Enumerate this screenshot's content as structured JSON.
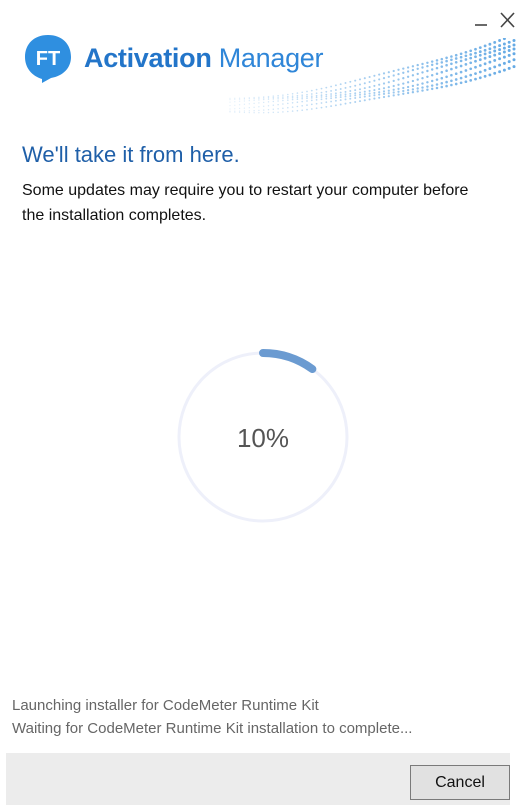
{
  "window": {
    "controls": {
      "minimize_icon": "minimize-icon",
      "close_icon": "close-icon"
    }
  },
  "brand": {
    "logo_text": "FT",
    "name_bold": "Activation",
    "name_light": " Manager",
    "accent_color": "#2375c9"
  },
  "main": {
    "heading": "We'll take it from here.",
    "description": "Some updates may require you to restart your computer before the installation completes."
  },
  "progress": {
    "percent": 10,
    "label": "10%",
    "track_color": "#eef0fa",
    "fill_color": "#6b9bd1"
  },
  "log": {
    "lines": [
      "Launching installer for CodeMeter Runtime Kit",
      "Waiting for CodeMeter Runtime Kit installation to complete..."
    ]
  },
  "footer": {
    "cancel_label": "Cancel"
  }
}
